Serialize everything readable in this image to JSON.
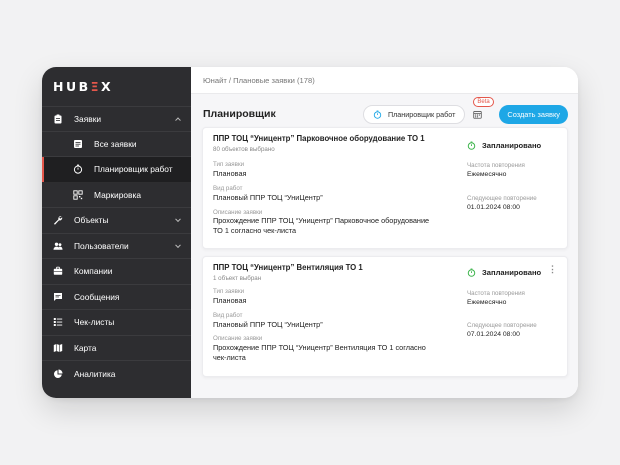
{
  "logo": {
    "pre": "HUB",
    "e": "Ξ",
    "post": "X"
  },
  "sidebar": {
    "items": [
      {
        "label": "Заявки",
        "icon": "clipboard-icon",
        "expanded": true
      },
      {
        "label": "Все заявки",
        "icon": "list-icon"
      },
      {
        "label": "Планировщик работ",
        "icon": "stopwatch-icon",
        "active": true
      },
      {
        "label": "Маркировка",
        "icon": "qr-code-icon"
      },
      {
        "label": "Объекты",
        "icon": "wrench-icon"
      },
      {
        "label": "Пользователи",
        "icon": "users-icon"
      },
      {
        "label": "Компании",
        "icon": "briefcase-icon"
      },
      {
        "label": "Сообщения",
        "icon": "chat-icon"
      },
      {
        "label": "Чек-листы",
        "icon": "checklist-icon"
      },
      {
        "label": "Карта",
        "icon": "map-icon"
      },
      {
        "label": "Аналитика",
        "icon": "pie-chart-icon"
      }
    ]
  },
  "breadcrumb": "Юнайт / Плановые заявки (178)",
  "header": {
    "title": "Планировщик",
    "planner_button": "Планировщик работ",
    "beta": "Beta",
    "create_button": "Создать заявку"
  },
  "colors": {
    "accent": "#1ea7e6",
    "brand": "#e4574b",
    "status": "#3cb44b",
    "sidebar": "#2d2d30"
  },
  "cards": [
    {
      "title": "ППР ТОЦ “Уницентр” Парковочное оборудование ТО 1",
      "subtitle": "80 объектов выбрано",
      "type_label": "Тип заявки",
      "type_value": "Плановая",
      "work_label": "Вид работ",
      "work_value": "Плановый ППР ТОЦ “УниЦентр”",
      "desc_label": "Описание заявки",
      "desc_line1": "Прохождение ППР ТОЦ “Уницентр” Парковочное оборудование",
      "desc_line2": "ТО 1 согласно чек-листа",
      "status": "Запланировано",
      "freq_label": "Частота повторения",
      "freq_value": "Ежемесячно",
      "next_label": "Следующее повторение",
      "next_value": "01.01.2024 08:00"
    },
    {
      "title": "ППР ТОЦ “Уницентр” Вентиляция ТО 1",
      "subtitle": "1 объект выбран",
      "type_label": "Тип заявки",
      "type_value": "Плановая",
      "work_label": "Вид работ",
      "work_value": "Плановый ППР ТОЦ “УниЦентр”",
      "desc_label": "Описание заявки",
      "desc_line1": "Прохождение ППР ТОЦ “Уницентр” Вентиляция ТО 1 согласно",
      "desc_line2": "чек-листа",
      "status": "Запланировано",
      "freq_label": "Частота повторения",
      "freq_value": "Ежемесячно",
      "next_label": "Следующее повторение",
      "next_value": "07.01.2024 08:00",
      "more": "⋮"
    }
  ]
}
